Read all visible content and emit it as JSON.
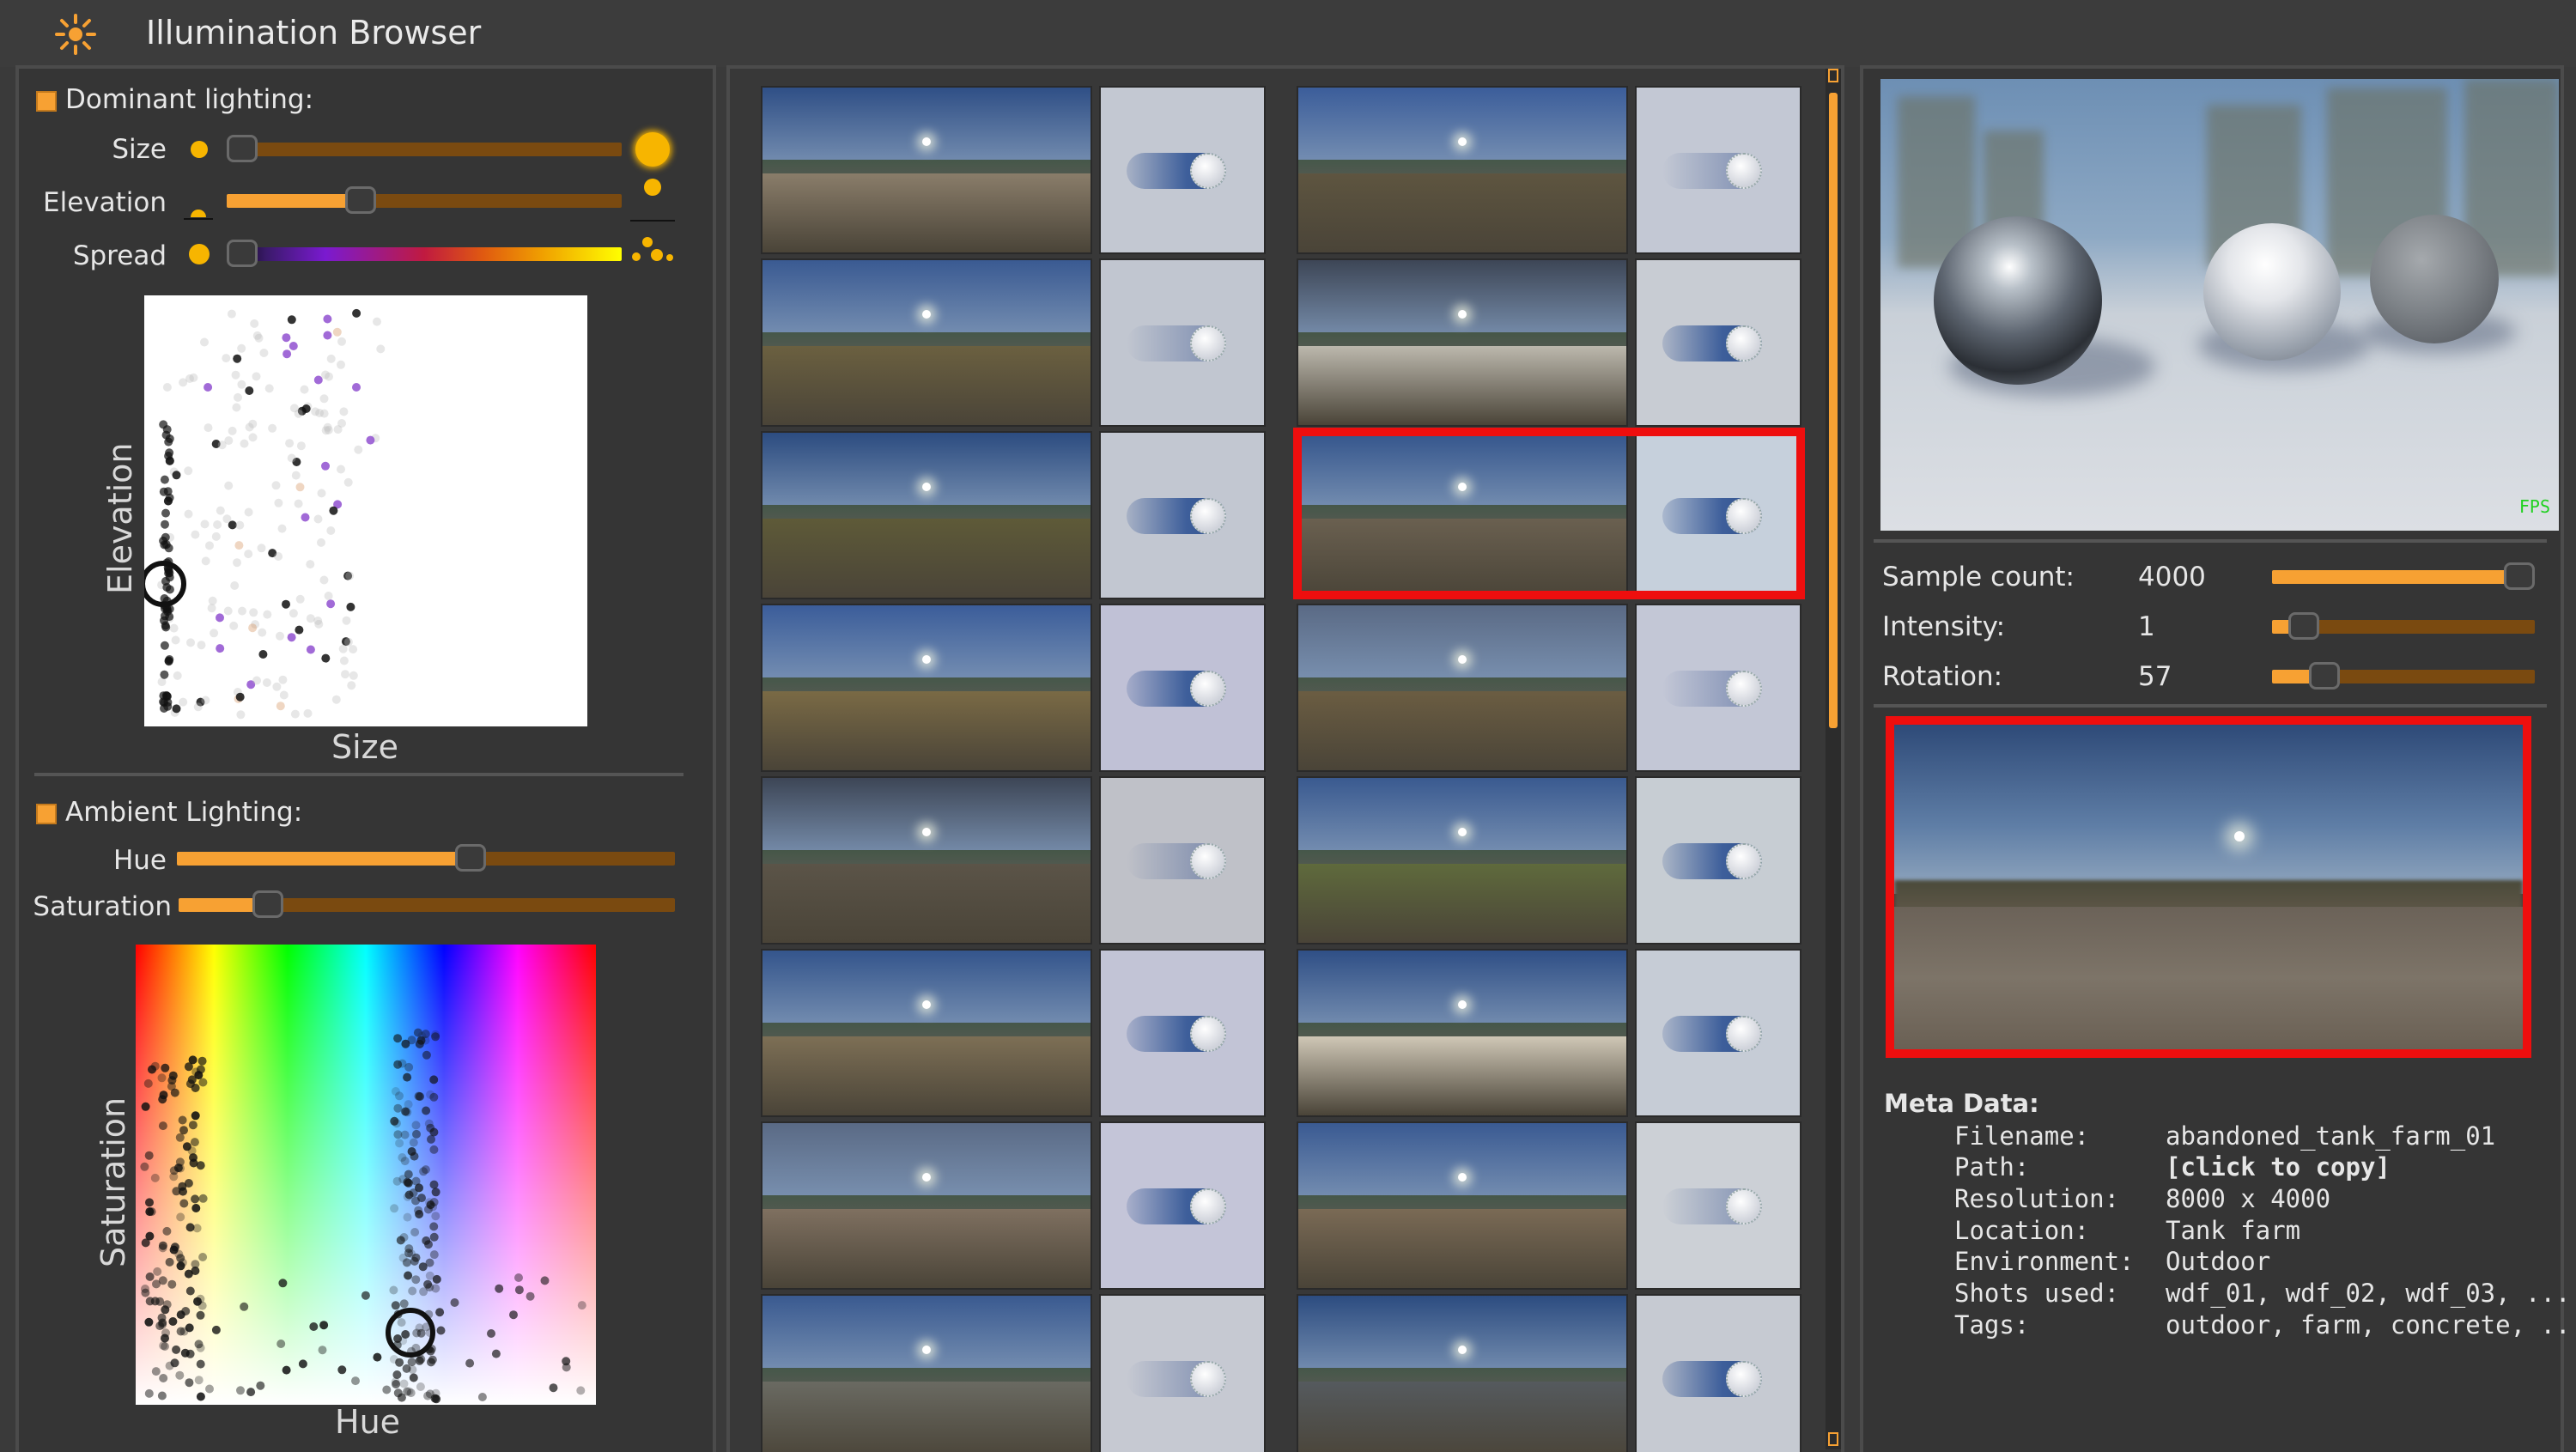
{
  "app": {
    "title": "Illumination Browser",
    "icon": "sun-icon",
    "accent": "#f7a133"
  },
  "dominant": {
    "title": "Dominant lighting:",
    "enabled": true,
    "size_label": "Size",
    "size_value": 0.04,
    "elevation_label": "Elevation",
    "elevation_value": 0.34,
    "spread_label": "Spread",
    "spread_value": 0.02,
    "plot": {
      "xlabel": "Size",
      "ylabel": "Elevation"
    }
  },
  "ambient": {
    "title": "Ambient Lighting:",
    "enabled": true,
    "hue_label": "Hue",
    "hue_value": 0.59,
    "saturation_label": "Saturation",
    "saturation_value": 0.18,
    "plot": {
      "xlabel": "Hue",
      "ylabel": "Saturation"
    }
  },
  "browser": {
    "selected": "abandoned_tank_farm_01",
    "rows": 8,
    "columns": 2
  },
  "render": {
    "fps": "FPS",
    "sample_count_label": "Sample count:",
    "sample_count": "4000",
    "sample_count_fraction": 0.95,
    "intensity_label": "Intensity:",
    "intensity": "1",
    "intensity_fraction": 0.12,
    "rotation_label": "Rotation:",
    "rotation": "57",
    "rotation_fraction": 0.2
  },
  "meta": {
    "title": "Meta Data:",
    "filename_label": "Filename:",
    "filename": "abandoned_tank_farm_01",
    "path_label": "Path:",
    "path": "[click to copy]",
    "resolution_label": "Resolution:",
    "resolution": "8000 x 4000",
    "location_label": "Location:",
    "location": "Tank farm",
    "environment_label": "Environment:",
    "environment": "Outdoor",
    "shots_label": "Shots used:",
    "shots": "wdf_01, wdf_02, wdf_03, ...",
    "tags_label": "Tags:",
    "tags": "outdoor, farm, concrete, ..."
  }
}
